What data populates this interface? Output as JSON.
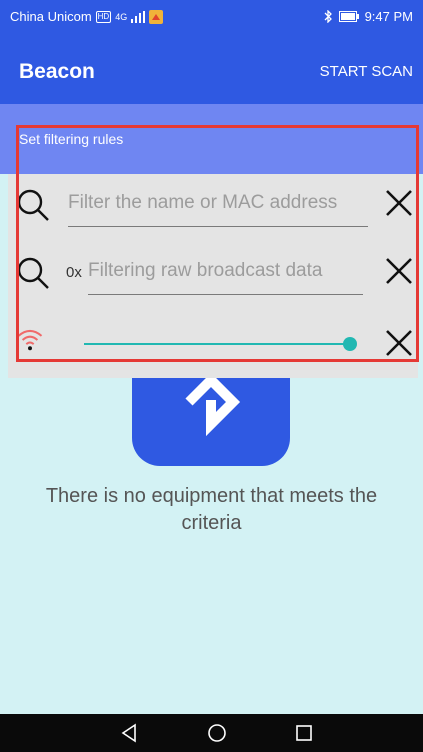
{
  "status_bar": {
    "carrier": "China Unicom",
    "hd_badge": "HD",
    "network_type": "4G",
    "time": "9:47 PM"
  },
  "app_bar": {
    "title": "Beacon",
    "action_label": "START SCAN"
  },
  "filter": {
    "header": "Set filtering rules",
    "name_placeholder": "Filter the name or MAC address",
    "raw_prefix": "0x",
    "raw_placeholder": "Filtering raw broadcast data",
    "rssi_level": 1.0
  },
  "empty_state": {
    "line1": "There is no equipment that meets the",
    "line2": "criteria"
  },
  "colors": {
    "primary": "#2f59e2",
    "accent": "#21b8b2",
    "highlight": "#e53935",
    "wifi_icon": "#f06a6a"
  },
  "icons": {
    "search": "search-icon",
    "close": "close-icon",
    "wifi": "wifi-signal-icon",
    "bluetooth": "bluetooth-icon",
    "battery": "battery-icon",
    "nav_back": "nav-back-icon",
    "nav_home": "nav-home-icon",
    "nav_recent": "nav-recent-apps-icon"
  }
}
